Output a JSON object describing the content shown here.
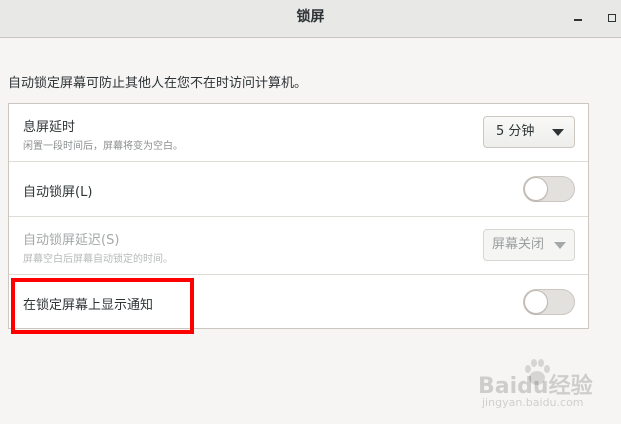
{
  "window": {
    "title": "锁屏"
  },
  "description": "自动锁定屏幕可防止其他人在您不在时访问计算机。",
  "settings": [
    {
      "title": "息屏延时",
      "subtitle": "闲置一段时间后，屏幕将变为空白。",
      "control": "dropdown",
      "value": "5 分钟",
      "enabled": true
    },
    {
      "title": "自动锁屏(L)",
      "control": "switch",
      "on": false,
      "enabled": true
    },
    {
      "title": "自动锁屏延迟(S)",
      "subtitle": "屏幕空白后屏幕自动锁定的时间。",
      "control": "dropdown",
      "value": "屏幕关闭",
      "enabled": false
    },
    {
      "title": "在锁定屏幕上显示通知",
      "control": "switch",
      "on": false,
      "enabled": true
    }
  ],
  "annotation": {
    "highlight_color": "#ff0000"
  },
  "watermark": {
    "text": "Baidu经验",
    "url": "jingyan.baidu.com"
  },
  "colors": {
    "titlebar": "#e8e8e7",
    "panel": "#ffffff",
    "background": "#f6f5f4"
  }
}
